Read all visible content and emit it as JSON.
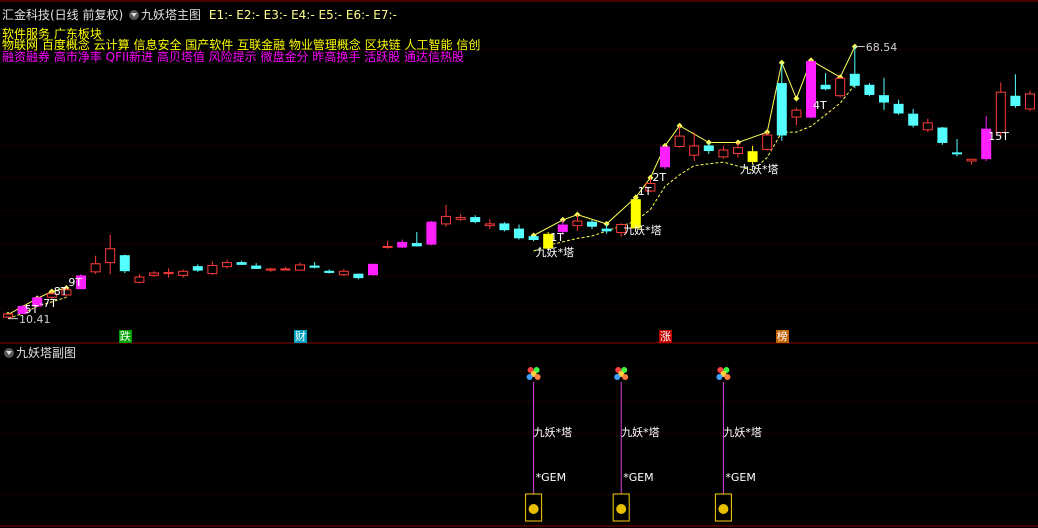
{
  "main_header": {
    "stock": "汇金科技(日线 前复权)",
    "indicator": "九妖塔主图",
    "e_values": [
      {
        "label": "E1:",
        "value": "-"
      },
      {
        "label": "E2:",
        "value": "-"
      },
      {
        "label": "E3:",
        "value": "-"
      },
      {
        "label": "E4:",
        "value": "-"
      },
      {
        "label": "E5:",
        "value": "-"
      },
      {
        "label": "E6:",
        "value": "-"
      },
      {
        "label": "E7:",
        "value": "-"
      }
    ],
    "concept_line1": "软件服务  广东板块",
    "concept_line2": "物联网 百度概念 云计算 信息安全 国产软件 互联金融 物业管理概念 区块链 人工智能 信创",
    "concept_line3": "融资融券 高市净率 QFII新进 高贝塔值 风险提示 微盘金分 昨高换手 活跃股 通达信热股"
  },
  "sub_header": {
    "indicator": "九妖塔副图"
  },
  "colors": {
    "background": "#000000",
    "up_candle": "#ff3c3c",
    "down_candle": "#54ffff",
    "magenta_candle": "#ff20ff",
    "yellow_candle": "#ffff00",
    "zigzag": "#ffff55",
    "grid": "#5a0000",
    "label": "#ffffff",
    "concept_yellow": "#ffff00",
    "concept_magenta": "#ff00ff",
    "signal_line": "#e040e0"
  },
  "chart_data": [
    {
      "type": "candlestick",
      "title": "九妖塔主图",
      "candles": [
        {
          "o": 10.28,
          "h": 10.62,
          "l": 10.2,
          "c": 10.55,
          "style": "up"
        },
        {
          "o": 10.6,
          "h": 11.3,
          "l": 10.55,
          "c": 11.2,
          "style": "magenta"
        },
        {
          "o": 11.25,
          "h": 12.05,
          "l": 11.15,
          "c": 11.95,
          "style": "magenta"
        },
        {
          "o": 12.0,
          "h": 12.5,
          "l": 11.85,
          "c": 12.3,
          "style": "up"
        },
        {
          "o": 12.2,
          "h": 12.8,
          "l": 12.05,
          "c": 12.65,
          "style": "up"
        },
        {
          "o": 12.75,
          "h": 14.0,
          "l": 12.7,
          "c": 13.85,
          "style": "magenta"
        },
        {
          "o": 14.2,
          "h": 15.6,
          "l": 14.0,
          "c": 14.9,
          "style": "up"
        },
        {
          "o": 15.0,
          "h": 17.4,
          "l": 14.0,
          "c": 16.2,
          "style": "up"
        },
        {
          "o": 15.6,
          "h": 15.7,
          "l": 14.1,
          "c": 14.3,
          "style": "down"
        },
        {
          "o": 13.3,
          "h": 14.0,
          "l": 13.2,
          "c": 13.75,
          "style": "up"
        },
        {
          "o": 13.9,
          "h": 14.25,
          "l": 13.75,
          "c": 14.1,
          "style": "up"
        },
        {
          "o": 14.15,
          "h": 14.5,
          "l": 13.7,
          "c": 14.05,
          "style": "up"
        },
        {
          "o": 13.9,
          "h": 14.4,
          "l": 13.7,
          "c": 14.25,
          "style": "up"
        },
        {
          "o": 14.65,
          "h": 14.85,
          "l": 14.2,
          "c": 14.35,
          "style": "down"
        },
        {
          "o": 14.05,
          "h": 15.1,
          "l": 13.95,
          "c": 14.75,
          "style": "up"
        },
        {
          "o": 14.65,
          "h": 15.25,
          "l": 14.5,
          "c": 15.0,
          "style": "up"
        },
        {
          "o": 15.0,
          "h": 15.15,
          "l": 14.8,
          "c": 14.85,
          "style": "down"
        },
        {
          "o": 14.7,
          "h": 14.95,
          "l": 14.45,
          "c": 14.5,
          "style": "down"
        },
        {
          "o": 14.35,
          "h": 14.55,
          "l": 14.2,
          "c": 14.45,
          "style": "up"
        },
        {
          "o": 14.45,
          "h": 14.65,
          "l": 14.35,
          "c": 14.4,
          "style": "up"
        },
        {
          "o": 14.35,
          "h": 15.0,
          "l": 14.3,
          "c": 14.8,
          "style": "up"
        },
        {
          "o": 14.7,
          "h": 15.05,
          "l": 14.5,
          "c": 14.6,
          "style": "down"
        },
        {
          "o": 14.25,
          "h": 14.4,
          "l": 14.05,
          "c": 14.15,
          "style": "down"
        },
        {
          "o": 13.95,
          "h": 14.45,
          "l": 13.85,
          "c": 14.25,
          "style": "up"
        },
        {
          "o": 14.0,
          "h": 14.05,
          "l": 13.55,
          "c": 13.7,
          "style": "down"
        },
        {
          "o": 13.95,
          "h": 14.9,
          "l": 13.9,
          "c": 14.85,
          "style": "magenta"
        },
        {
          "o": 16.4,
          "h": 16.9,
          "l": 16.2,
          "c": 16.4,
          "style": "up"
        },
        {
          "o": 16.35,
          "h": 17.0,
          "l": 16.25,
          "c": 16.75,
          "style": "magenta"
        },
        {
          "o": 16.45,
          "h": 17.65,
          "l": 16.4,
          "c": 16.65,
          "style": "down"
        },
        {
          "o": 16.6,
          "h": 18.6,
          "l": 16.5,
          "c": 18.5,
          "style": "magenta"
        },
        {
          "o": 18.35,
          "h": 20.0,
          "l": 18.1,
          "c": 19.0,
          "style": "up"
        },
        {
          "o": 18.9,
          "h": 19.2,
          "l": 18.6,
          "c": 18.75,
          "style": "up"
        },
        {
          "o": 18.55,
          "h": 19.1,
          "l": 18.4,
          "c": 18.9,
          "style": "down"
        },
        {
          "o": 18.35,
          "h": 18.75,
          "l": 17.9,
          "c": 18.2,
          "style": "up"
        },
        {
          "o": 18.35,
          "h": 18.5,
          "l": 17.7,
          "c": 17.85,
          "style": "down"
        },
        {
          "o": 17.9,
          "h": 18.3,
          "l": 17.0,
          "c": 17.15,
          "style": "down"
        },
        {
          "o": 17.25,
          "h": 17.35,
          "l": 16.85,
          "c": 17.0,
          "style": "down"
        },
        {
          "o": 16.25,
          "h": 17.65,
          "l": 16.1,
          "c": 17.45,
          "style": "yellow"
        },
        {
          "o": 17.7,
          "h": 18.7,
          "l": 17.4,
          "c": 18.25,
          "style": "magenta"
        },
        {
          "o": 18.2,
          "h": 19.15,
          "l": 17.75,
          "c": 18.6,
          "style": "up"
        },
        {
          "o": 18.5,
          "h": 18.7,
          "l": 17.9,
          "c": 18.15,
          "style": "down"
        },
        {
          "o": 17.9,
          "h": 18.35,
          "l": 17.5,
          "c": 17.75,
          "style": "down"
        },
        {
          "o": 17.6,
          "h": 18.4,
          "l": 17.25,
          "c": 18.3,
          "style": "up"
        },
        {
          "o": 18.0,
          "h": 20.65,
          "l": 17.85,
          "c": 20.45,
          "style": "yellow"
        },
        {
          "o": 21.2,
          "h": 22.35,
          "l": 21.1,
          "c": 21.85,
          "style": "up"
        },
        {
          "o": 23.3,
          "h": 25.1,
          "l": 23.1,
          "c": 25.0,
          "style": "magenta"
        },
        {
          "o": 25.05,
          "h": 26.85,
          "l": 24.95,
          "c": 25.95,
          "style": "up"
        },
        {
          "o": 24.3,
          "h": 26.3,
          "l": 23.8,
          "c": 25.1,
          "style": "up"
        },
        {
          "o": 25.1,
          "h": 25.4,
          "l": 24.4,
          "c": 24.7,
          "style": "down"
        },
        {
          "o": 24.15,
          "h": 25.1,
          "l": 24.0,
          "c": 24.75,
          "style": "up"
        },
        {
          "o": 24.45,
          "h": 25.4,
          "l": 24.1,
          "c": 24.95,
          "style": "up"
        },
        {
          "o": 23.75,
          "h": 25.1,
          "l": 23.5,
          "c": 24.6,
          "style": "yellow"
        },
        {
          "o": 24.8,
          "h": 26.3,
          "l": 24.7,
          "c": 26.05,
          "style": "up"
        },
        {
          "o": 26.05,
          "h": 32.3,
          "l": 25.55,
          "c": 30.5,
          "style": "down"
        },
        {
          "o": 27.6,
          "h": 28.4,
          "l": 26.9,
          "c": 28.2,
          "style": "up"
        },
        {
          "o": 27.6,
          "h": 32.5,
          "l": 27.5,
          "c": 32.4,
          "style": "magenta"
        },
        {
          "o": 30.35,
          "h": 31.4,
          "l": 29.9,
          "c": 30.05,
          "style": "down"
        },
        {
          "o": 29.45,
          "h": 31.05,
          "l": 29.3,
          "c": 30.95,
          "style": "up"
        },
        {
          "o": 31.3,
          "h": 33.7,
          "l": 30.1,
          "c": 30.35,
          "style": "down"
        },
        {
          "o": 30.35,
          "h": 30.55,
          "l": 29.4,
          "c": 29.55,
          "style": "down"
        },
        {
          "o": 29.45,
          "h": 31.0,
          "l": 28.2,
          "c": 28.9,
          "style": "down"
        },
        {
          "o": 28.7,
          "h": 29.1,
          "l": 27.8,
          "c": 27.95,
          "style": "down"
        },
        {
          "o": 27.85,
          "h": 28.3,
          "l": 26.7,
          "c": 26.9,
          "style": "down"
        },
        {
          "o": 26.5,
          "h": 27.45,
          "l": 26.3,
          "c": 27.1,
          "style": "up"
        },
        {
          "o": 26.65,
          "h": 26.75,
          "l": 25.2,
          "c": 25.4,
          "style": "down"
        },
        {
          "o": 24.5,
          "h": 25.7,
          "l": 24.2,
          "c": 24.5,
          "style": "down"
        },
        {
          "o": 23.8,
          "h": 24.0,
          "l": 23.5,
          "c": 23.95,
          "style": "up"
        },
        {
          "o": 24.0,
          "h": 27.7,
          "l": 23.8,
          "c": 26.55,
          "style": "magenta"
        },
        {
          "o": 26.25,
          "h": 30.6,
          "l": 25.8,
          "c": 29.75,
          "style": "up"
        },
        {
          "o": 29.4,
          "h": 31.3,
          "l": 28.4,
          "c": 28.6,
          "style": "down"
        },
        {
          "o": 28.3,
          "h": 29.9,
          "l": 28.1,
          "c": 29.6,
          "style": "up"
        },
        {
          "o": 29.55,
          "h": 30.15,
          "l": 29.0,
          "c": 30.0,
          "style": "up"
        }
      ],
      "zigzag": [
        {
          "i": 0,
          "v": 10.5
        },
        {
          "i": 2,
          "v": 11.9
        },
        {
          "i": 3,
          "v": 12.5
        },
        {
          "i": 4,
          "v": 12.8
        },
        {
          "i": 36,
          "v": 17.35
        },
        {
          "i": 38,
          "v": 18.7
        },
        {
          "i": 39,
          "v": 19.15
        },
        {
          "i": 41,
          "v": 18.35
        },
        {
          "i": 43,
          "v": 20.65
        },
        {
          "i": 44,
          "v": 22.35
        },
        {
          "i": 45,
          "v": 25.1
        },
        {
          "i": 46,
          "v": 26.85
        },
        {
          "i": 48,
          "v": 25.4
        },
        {
          "i": 50,
          "v": 25.4
        },
        {
          "i": 52,
          "v": 26.3
        },
        {
          "i": 53,
          "v": 32.3
        },
        {
          "i": 54,
          "v": 29.2
        },
        {
          "i": 55,
          "v": 32.5
        },
        {
          "i": 57,
          "v": 31.05
        },
        {
          "i": 58,
          "v": 33.7
        }
      ],
      "zigzag_dashed": [
        {
          "i": 0,
          "v": 10.15
        },
        {
          "i": 1,
          "v": 10.6
        },
        {
          "i": 2,
          "v": 11.2
        },
        {
          "i": 3,
          "v": 11.6
        },
        {
          "i": 4,
          "v": 12.0
        },
        {
          "i": 36,
          "v": 16.0
        },
        {
          "i": 37,
          "v": 16.5
        },
        {
          "i": 39,
          "v": 17.1
        },
        {
          "i": 40,
          "v": 17.3
        },
        {
          "i": 43,
          "v": 18.6
        },
        {
          "i": 44,
          "v": 19.6
        },
        {
          "i": 45,
          "v": 21.6
        },
        {
          "i": 46,
          "v": 22.6
        },
        {
          "i": 47,
          "v": 23.4
        },
        {
          "i": 49,
          "v": 23.7
        },
        {
          "i": 51,
          "v": 23.0
        },
        {
          "i": 52,
          "v": 24.1
        },
        {
          "i": 53,
          "v": 26.3
        },
        {
          "i": 54,
          "v": 26.3
        },
        {
          "i": 55,
          "v": 26.8
        },
        {
          "i": 57,
          "v": 28.8
        },
        {
          "i": 58,
          "v": 30.4
        }
      ],
      "price_labels": [
        {
          "i": 58,
          "v": 33.7,
          "text": "68.54"
        },
        {
          "i": 0,
          "v": 10.15,
          "text": "10.41"
        }
      ],
      "annotations": [
        {
          "i": 1,
          "v": 11.0,
          "text": "5T"
        },
        {
          "i": 2,
          "v": 11.5,
          "text": "-7T"
        },
        {
          "i": 3,
          "v": 12.55,
          "text": "8T"
        },
        {
          "i": 4,
          "v": 13.35,
          "text": "9T"
        },
        {
          "i": 37,
          "v": 17.2,
          "text": "1T"
        },
        {
          "i": 43,
          "v": 21.2,
          "text": "1T"
        },
        {
          "i": 44,
          "v": 22.4,
          "text": "2T"
        },
        {
          "i": 55,
          "v": 28.6,
          "text": "4T"
        },
        {
          "i": 67,
          "v": 26.0,
          "text": "15T"
        },
        {
          "i": 36,
          "v": 15.9,
          "text": "九妖*塔"
        },
        {
          "i": 42,
          "v": 17.8,
          "text": "九妖*塔"
        },
        {
          "i": 50,
          "v": 23.1,
          "text": "九妖*塔"
        }
      ],
      "badges": [
        {
          "i": 8,
          "text": "跌",
          "fg": "#ffffff",
          "bg": "#00a000"
        },
        {
          "i": 20,
          "text": "财",
          "fg": "#ffffff",
          "bg": "#00a0c0"
        },
        {
          "i": 45,
          "text": "涨",
          "fg": "#ffffff",
          "bg": "#c00000"
        },
        {
          "i": 53,
          "text": "榜",
          "fg": "#ffffff",
          "bg": "#c06000"
        }
      ],
      "ylim": [
        9.6,
        36.0
      ]
    },
    {
      "type": "signal",
      "title": "九妖塔副图",
      "signals": [
        {
          "i": 36,
          "tower_text": "九妖*塔",
          "gem_text": "*GEM"
        },
        {
          "i": 42,
          "tower_text": "九妖*塔",
          "gem_text": "*GEM"
        },
        {
          "i": 49,
          "tower_text": "九妖*塔",
          "gem_text": "*GEM"
        }
      ]
    }
  ]
}
